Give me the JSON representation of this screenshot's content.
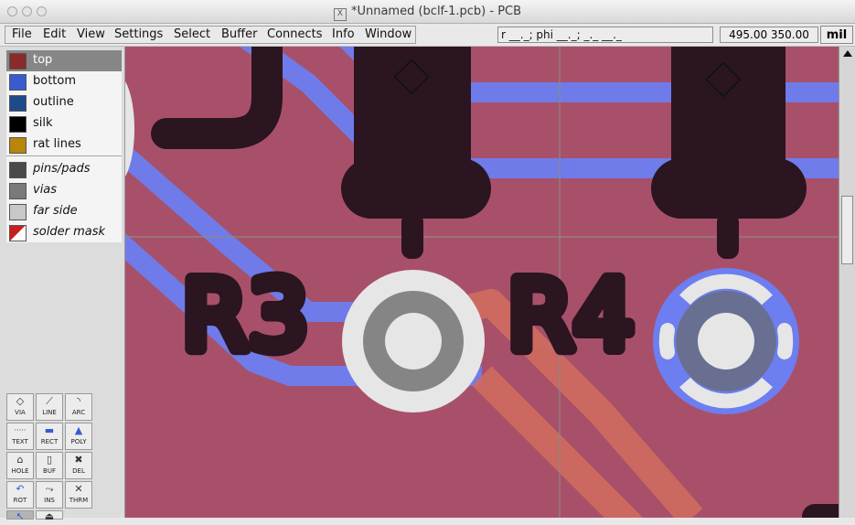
{
  "window": {
    "title": "*Unnamed (bclf-1.pcb) - PCB"
  },
  "menu": [
    "File",
    "Edit",
    "View",
    "Settings",
    "Select",
    "Buffer",
    "Connects",
    "Info",
    "Window"
  ],
  "statusbar": {
    "cursor": "r __._; phi __._; _._ __._",
    "coords": "495.00 350.00",
    "unit": "mil"
  },
  "layers": [
    {
      "label": "top",
      "color": "#8b2a2a",
      "selected": true
    },
    {
      "label": "bottom",
      "color": "#3a5bd0"
    },
    {
      "label": "outline",
      "color": "#1f4a8a"
    },
    {
      "label": "silk",
      "color": "#000000"
    },
    {
      "label": "rat lines",
      "color": "#b8860b"
    }
  ],
  "special_layers": [
    {
      "label": "pins/pads",
      "color": "#4a4a4a"
    },
    {
      "label": "vias",
      "color": "#7a7a7a"
    },
    {
      "label": "far side",
      "color": "#c8c8c8"
    },
    {
      "label": "solder mask",
      "color": "#c81e1e"
    }
  ],
  "tools": [
    {
      "label": "VIA",
      "icon": "via-icon"
    },
    {
      "label": "LINE",
      "icon": "line-icon"
    },
    {
      "label": "ARC",
      "icon": "arc-icon"
    },
    {
      "label": "TEXT",
      "icon": "text-icon"
    },
    {
      "label": "RECT",
      "icon": "rect-icon"
    },
    {
      "label": "POLY",
      "icon": "poly-icon"
    },
    {
      "label": "HOLE",
      "icon": "hole-icon"
    },
    {
      "label": "BUF",
      "icon": "buffer-icon"
    },
    {
      "label": "DEL",
      "icon": "delete-icon"
    },
    {
      "label": "ROT",
      "icon": "rotate-icon"
    },
    {
      "label": "INS",
      "icon": "insert-icon"
    },
    {
      "label": "THRM",
      "icon": "thermal-icon"
    },
    {
      "label": "",
      "icon": "arrow-icon"
    },
    {
      "label": "",
      "icon": "lock-icon"
    }
  ],
  "board": {
    "refdes": [
      "R3",
      "R4"
    ],
    "colors": {
      "board": "#a8506a",
      "bottom_trace": "#6c7ef0",
      "top_trace": "#cf6b60",
      "silk": "#2a1520",
      "pad_white": "#e6e6e6",
      "via_gray": "#858585"
    }
  }
}
